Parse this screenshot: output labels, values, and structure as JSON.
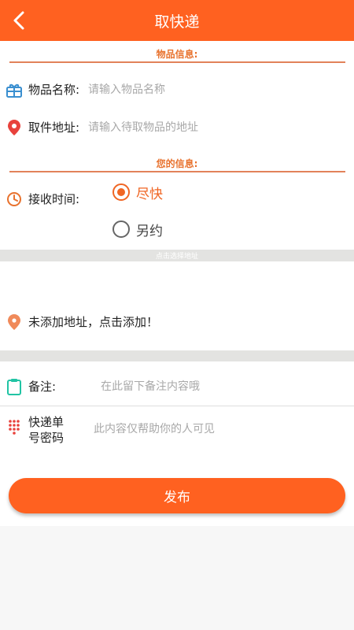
{
  "header": {
    "title": "取快递"
  },
  "item_section": {
    "title": "物品信息:",
    "name_label": "物品名称:",
    "name_placeholder": "请输入物品名称",
    "location_label": "取件地址:",
    "location_placeholder": "请输入待取物品的地址"
  },
  "user_section": {
    "title": "您的信息:",
    "time_label": "接收时间:",
    "options": [
      {
        "label": "尽快",
        "selected": true
      },
      {
        "label": "另约",
        "selected": false
      }
    ]
  },
  "address_band": {
    "text": "点击选择地址"
  },
  "address": {
    "text": "未添加地址，点击添加！"
  },
  "note": {
    "label": "备注:",
    "placeholder": "在此留下备注内容哦"
  },
  "tracking": {
    "label_line1": "快递单",
    "label_line2": "号密码",
    "placeholder": "此内容仅帮助你的人可见"
  },
  "publish_button": {
    "label": "发布"
  },
  "colors": {
    "accent": "#ff6120",
    "section_title": "#e8722e",
    "icon_blue": "#3a8fd0",
    "icon_red": "#e8423c",
    "icon_green": "#21c4a4"
  },
  "icons": [
    "back-arrow-icon",
    "gift-icon",
    "location-pin-icon",
    "clock-icon",
    "map-pin-icon",
    "clipboard-icon",
    "dots-grid-icon"
  ]
}
